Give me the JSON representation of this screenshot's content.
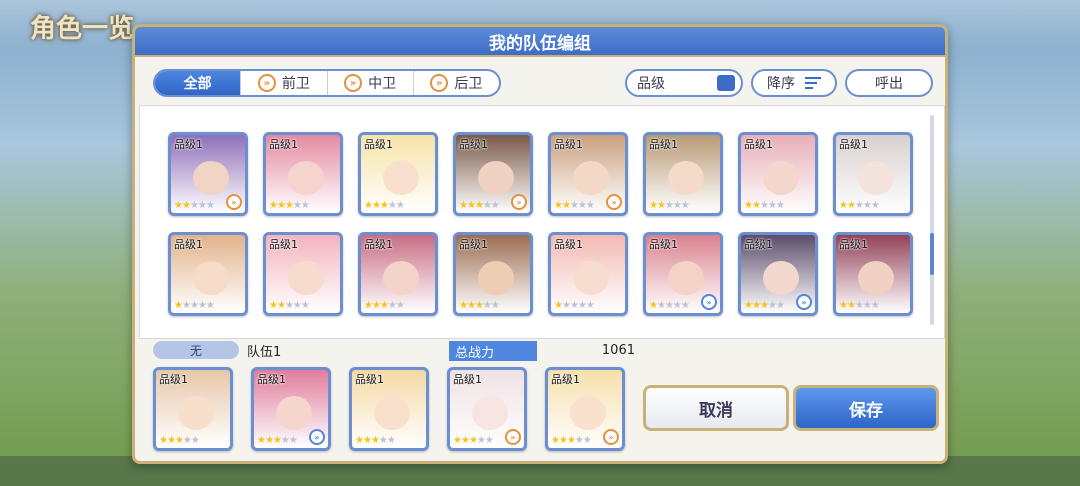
{
  "background": {
    "title": "角色一览"
  },
  "modal": {
    "title": "我的队伍编组",
    "tabs": [
      {
        "label": "全部",
        "active": true,
        "icon": ""
      },
      {
        "label": "前卫",
        "active": false,
        "icon": "chevron-role-icon"
      },
      {
        "label": "中卫",
        "active": false,
        "icon": "chevron-role-icon"
      },
      {
        "label": "后卫",
        "active": false,
        "icon": "chevron-role-icon"
      }
    ],
    "sort_field": "品级",
    "order_label": "降序",
    "call_label": "呼出",
    "level_label": "品级1",
    "rows": [
      [
        {
          "stars": 2,
          "bg": "#8f6fb9",
          "face": "#f2d4c7",
          "arrow": "orange"
        },
        {
          "stars": 3,
          "bg": "#e48aa0",
          "face": "#f6d3cc",
          "arrow": "none"
        },
        {
          "stars": 3,
          "bg": "#f6e3a7",
          "face": "#f8e0cc",
          "arrow": "none"
        },
        {
          "stars": 3,
          "bg": "#7b5a4a",
          "face": "#f0d2c0",
          "arrow": "orange"
        },
        {
          "stars": 2,
          "bg": "#caa07f",
          "face": "#f3d8c6",
          "arrow": "orange"
        },
        {
          "stars": 2,
          "bg": "#b89a76",
          "face": "#f4dac8",
          "arrow": "none"
        },
        {
          "stars": 2,
          "bg": "#e7aeb7",
          "face": "#f5d6cc",
          "arrow": "none"
        },
        {
          "stars": 2,
          "bg": "#d8d0cf",
          "face": "#f4e2dc",
          "arrow": "none"
        }
      ],
      [
        {
          "stars": 1,
          "bg": "#e2b38b",
          "face": "#f6dcc6",
          "arrow": "none"
        },
        {
          "stars": 2,
          "bg": "#f2b4bf",
          "face": "#f7dccd",
          "arrow": "none"
        },
        {
          "stars": 3,
          "bg": "#c86e84",
          "face": "#f4d3c8",
          "arrow": "none"
        },
        {
          "stars": 3,
          "bg": "#9b6d52",
          "face": "#efcdb3",
          "arrow": "none"
        },
        {
          "stars": 1,
          "bg": "#f3b9b2",
          "face": "#f7ddd0",
          "arrow": "none"
        },
        {
          "stars": 1,
          "bg": "#d9828d",
          "face": "#f4d2c5",
          "arrow": "blue"
        },
        {
          "stars": 3,
          "bg": "#5b4d6b",
          "face": "#f2d7cf",
          "arrow": "blue"
        },
        {
          "stars": 2,
          "bg": "#93425a",
          "face": "#f1d1c2",
          "arrow": "none"
        }
      ]
    ],
    "team": {
      "tag": "无",
      "name": "队伍1",
      "power_label": "总战力",
      "power_value": "1061",
      "members": [
        {
          "stars": 3,
          "bg": "#e7c7a9",
          "face": "#f7dfcc",
          "arrow": "none"
        },
        {
          "stars": 3,
          "bg": "#e07d9c",
          "face": "#f6d5cc",
          "arrow": "blue"
        },
        {
          "stars": 3,
          "bg": "#f4d9a4",
          "face": "#f8e0cc",
          "arrow": "none"
        },
        {
          "stars": 3,
          "bg": "#efe1e4",
          "face": "#f7e5e2",
          "arrow": "orange"
        },
        {
          "stars": 3,
          "bg": "#f6dfaa",
          "face": "#f8e1cd",
          "arrow": "orange"
        }
      ]
    },
    "cancel_label": "取消",
    "save_label": "保存"
  },
  "colors": {
    "accent": "#3d6cc6",
    "frame": "#c9b27a",
    "star": "#f4c41a"
  }
}
